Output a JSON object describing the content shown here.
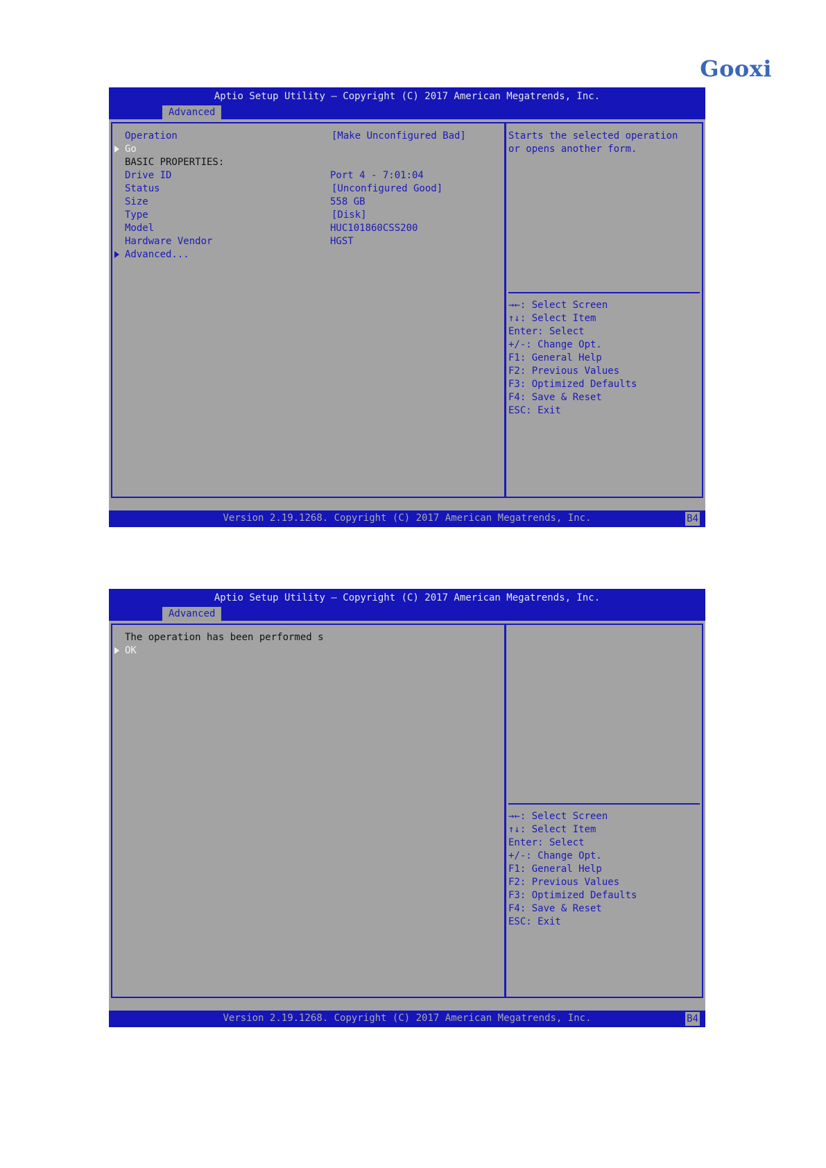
{
  "brand": {
    "logo_text": "Gooxi",
    "color": "#3a67b8"
  },
  "colors": {
    "bios_blue": "#1515b8",
    "panel_gray": "#a3a3a3",
    "text_blue": "#1a1ab8"
  },
  "screens": [
    {
      "title": "Aptio Setup Utility – Copyright (C) 2017 American Megatrends, Inc.",
      "tab": "Advanced",
      "items": [
        {
          "label": "Operation",
          "value": "[Make Unconfigured Bad]"
        },
        {
          "label": "Go"
        },
        {
          "label": "BASIC PROPERTIES:"
        },
        {
          "label": "Drive ID",
          "value": "Port 4 - 7:01:04"
        },
        {
          "label": "Status",
          "value": "[Unconfigured Good]"
        },
        {
          "label": "Size",
          "value": "558 GB"
        },
        {
          "label": "Type",
          "value": "[Disk]"
        },
        {
          "label": "Model",
          "value": "HUC101860CSS200"
        },
        {
          "label": "Hardware Vendor",
          "value": "HGST"
        },
        {
          "label": "Advanced..."
        }
      ],
      "help_text": [
        "Starts the selected operation",
        "or opens another form."
      ],
      "keys": [
        "→←: Select Screen",
        "↑↓: Select Item",
        "Enter: Select",
        "+/-: Change Opt.",
        "F1: General Help",
        "F2: Previous Values",
        "F3: Optimized Defaults",
        "F4: Save & Reset",
        "ESC: Exit"
      ],
      "footer": "Version 2.19.1268. Copyright (C) 2017 American Megatrends, Inc.",
      "badge": "B4"
    },
    {
      "title": "Aptio Setup Utility – Copyright (C) 2017 American Megatrends, Inc.",
      "tab": "Advanced",
      "items": [
        {
          "label": "The operation has been performed s"
        },
        {
          "label": "OK"
        }
      ],
      "keys": [
        "→←: Select Screen",
        "↑↓: Select Item",
        "Enter: Select",
        "+/-: Change Opt.",
        "F1: General Help",
        "F2: Previous Values",
        "F3: Optimized Defaults",
        "F4: Save & Reset",
        "ESC: Exit"
      ],
      "footer": "Version 2.19.1268. Copyright (C) 2017 American Megatrends, Inc.",
      "badge": "B4"
    }
  ]
}
